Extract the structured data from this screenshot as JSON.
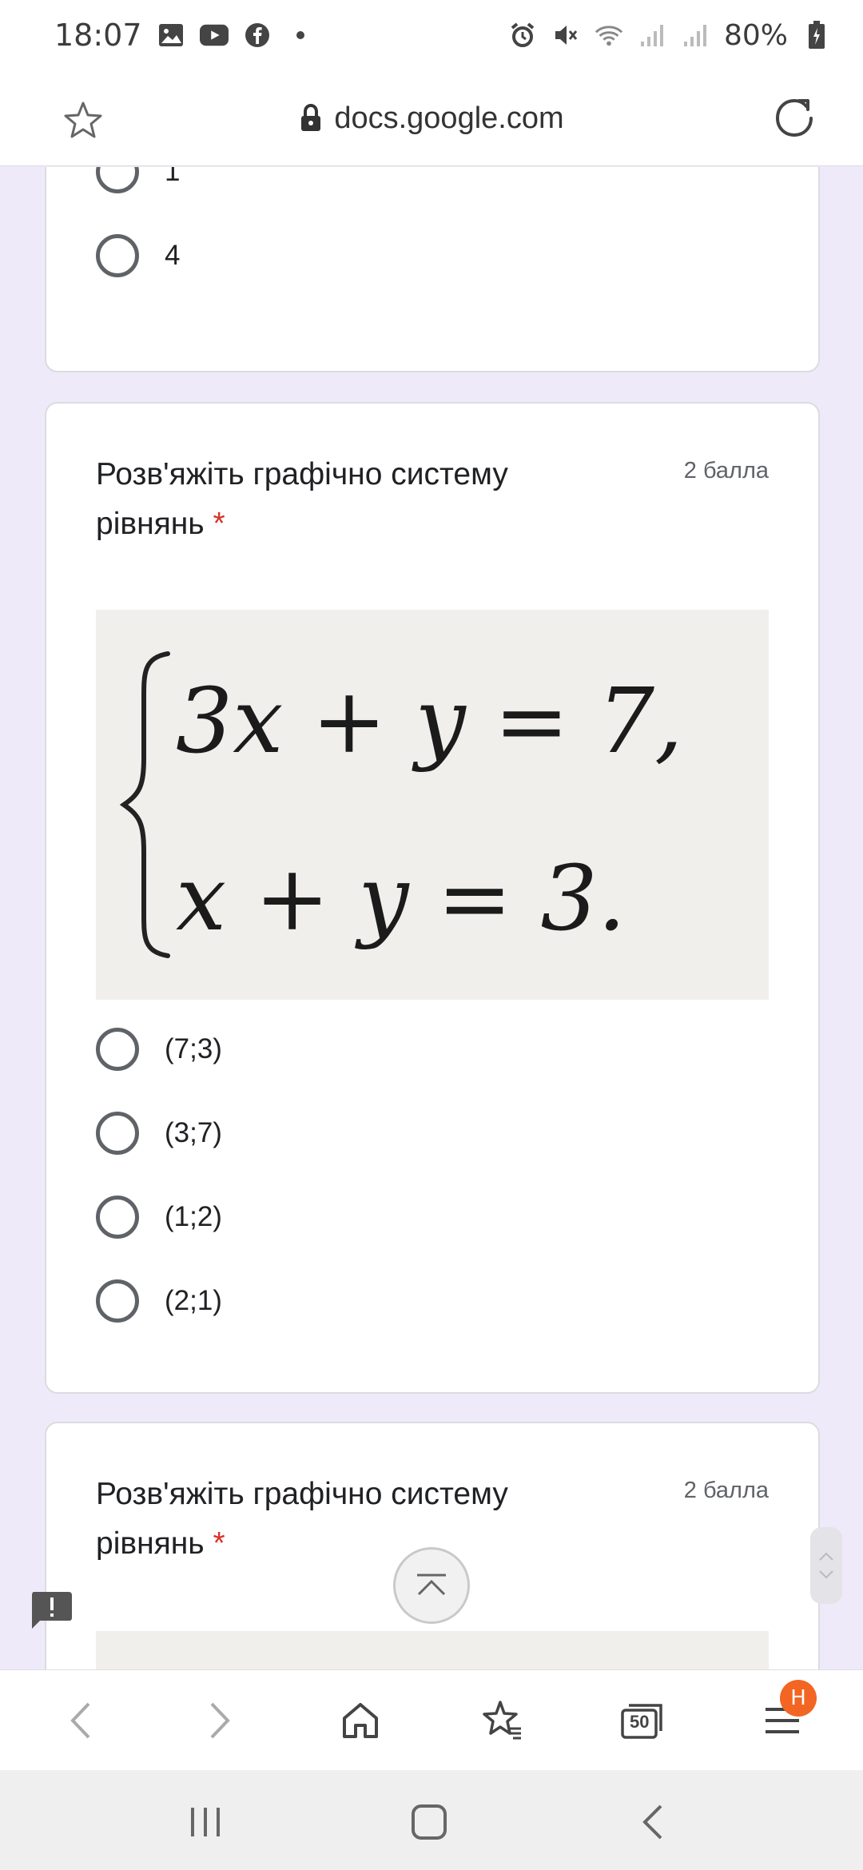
{
  "status_bar": {
    "time": "18:07",
    "battery": "80%",
    "icons_left": [
      "image-icon",
      "youtube-icon",
      "facebook-icon",
      "dot-icon"
    ],
    "icons_right": [
      "alarm-icon",
      "mute-icon",
      "wifi-icon",
      "signal-icon",
      "signal-icon",
      "battery-icon"
    ]
  },
  "browser": {
    "url": "docs.google.com"
  },
  "card1": {
    "options": [
      "1",
      "4"
    ]
  },
  "card2": {
    "title": "Розв'яжіть графічно систему рівнянь",
    "required_mark": "*",
    "points": "2 балла",
    "equation_line1": "3x + y = 7,",
    "equation_line2": "x + y = 3.",
    "options": [
      "(7;3)",
      "(3;7)",
      "(1;2)",
      "(2;1)"
    ]
  },
  "card3": {
    "title": "Розв'яжіть графічно систему рівнянь",
    "required_mark": "*",
    "points": "2 балла"
  },
  "bottom_nav": {
    "tabs_count": "50",
    "menu_badge": "Н"
  },
  "colors": {
    "background": "#efeafa",
    "required": "#d93025",
    "badge": "#f26522"
  }
}
